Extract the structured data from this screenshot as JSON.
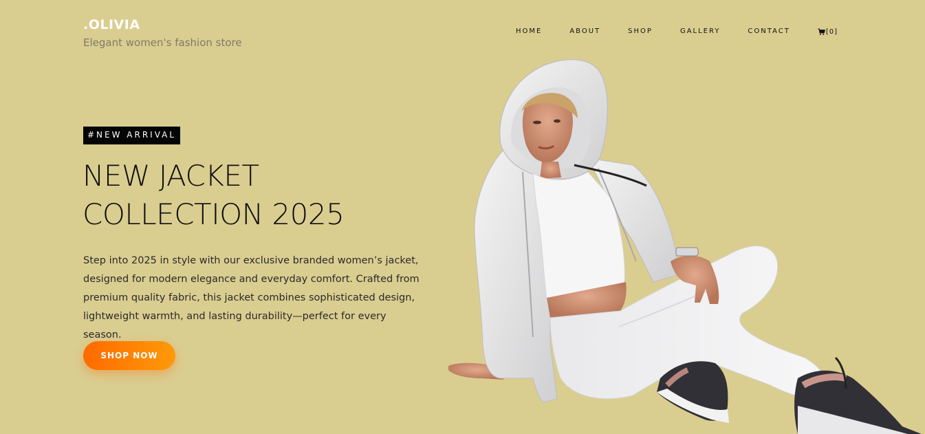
{
  "brand": {
    "name": ".OLIVIA",
    "tagline": "Elegant women's fashion store"
  },
  "nav": {
    "items": [
      {
        "label": "HOME"
      },
      {
        "label": "ABOUT"
      },
      {
        "label": "SHOP"
      },
      {
        "label": "GALLERY"
      },
      {
        "label": "CONTACT"
      }
    ],
    "cart": {
      "icon": "cart-icon",
      "count_text": "[0]"
    }
  },
  "hero": {
    "badge": "#NEW ARRIVAL",
    "headline_line1": "NEW JACKET",
    "headline_line2": "COLLECTION 2025",
    "description": "Step into 2025 in style with our exclusive branded women’s jacket, designed for modern elegance and everyday comfort. Crafted from premium quality fabric, this jacket combines sophisticated design, lightweight warmth, and lasting durability—perfect for every season.",
    "cta_label": "SHOP NOW"
  },
  "colors": {
    "background": "#dacd90",
    "accent_start": "#ff6a00",
    "accent_end": "#ff9a08",
    "badge_bg": "#050505"
  }
}
